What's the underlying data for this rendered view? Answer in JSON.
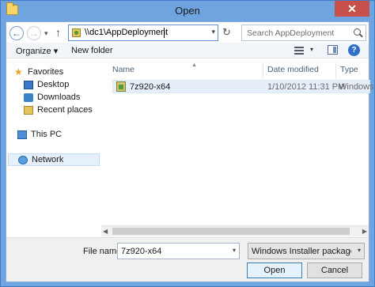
{
  "window": {
    "title": "Open",
    "close_symbol": "✕"
  },
  "address": {
    "path": "\\\\dc1\\AppDeployment",
    "refresh_symbol": "↻"
  },
  "search": {
    "placeholder": "Search AppDeployment"
  },
  "toolbar": {
    "organize_label": "Organize ▾",
    "new_folder_label": "New folder",
    "help_symbol": "?"
  },
  "nav_pane": {
    "favorites_label": "Favorites",
    "favorites_items": [
      "Desktop",
      "Downloads",
      "Recent places"
    ],
    "this_pc_label": "This PC",
    "network_label": "Network"
  },
  "columns": {
    "name": "Name",
    "date_modified": "Date modified",
    "type": "Type"
  },
  "files": [
    {
      "name": "7z920-x64",
      "date_modified": "1/10/2012 11:31 PM",
      "type": "Windows"
    }
  ],
  "bottom": {
    "file_name_label": "File name:",
    "file_name_value": "7z920-x64",
    "filter_value": "Windows Installer packages (*.r",
    "open_label": "Open",
    "cancel_label": "Cancel"
  }
}
